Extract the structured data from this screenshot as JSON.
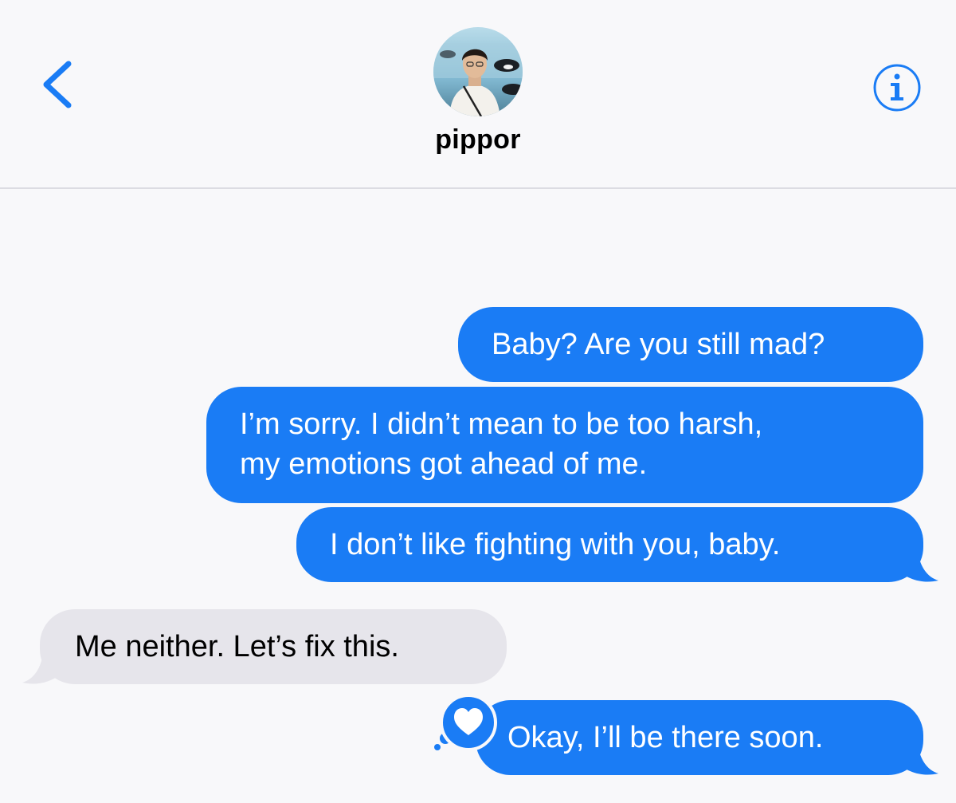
{
  "header": {
    "contact_name": "pippor",
    "back_icon": "chevron-left-icon",
    "info_icon": "info-circle-icon",
    "accent_color": "#1a7cf5"
  },
  "messages": [
    {
      "direction": "outgoing",
      "lines": [
        "Baby? Are you still mad?"
      ]
    },
    {
      "direction": "outgoing",
      "lines": [
        "I’m sorry. I didn’t mean to be too harsh,",
        "my emotions got ahead of me."
      ]
    },
    {
      "direction": "outgoing",
      "lines": [
        "I don’t like fighting with you, baby."
      ]
    },
    {
      "direction": "incoming",
      "lines": [
        "Me neither. Let’s fix this."
      ]
    },
    {
      "direction": "outgoing",
      "lines": [
        "Okay, I’ll be there soon."
      ],
      "reaction": "heart-icon"
    }
  ],
  "colors": {
    "outgoing_bubble": "#1a7cf5",
    "incoming_bubble": "#e6e5eb",
    "background": "#f8f8fa"
  }
}
